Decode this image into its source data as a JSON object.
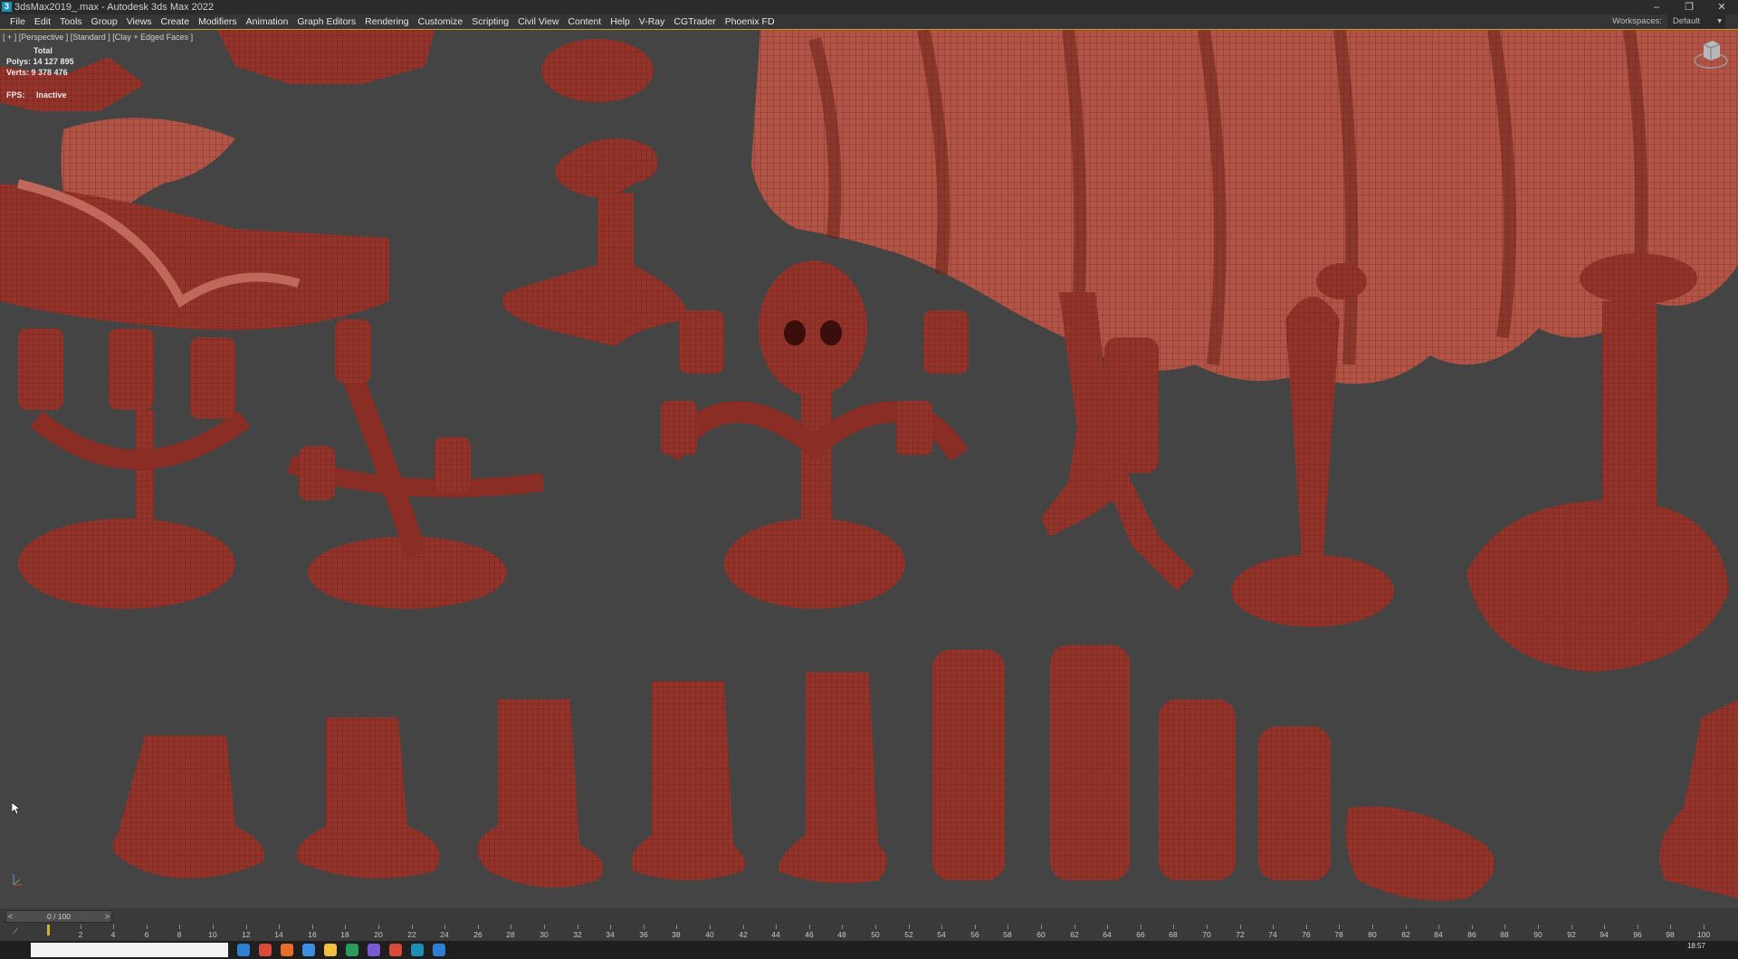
{
  "window": {
    "title": "3dsMax2019_.max - Autodesk 3ds Max 2022",
    "app_icon": "3",
    "controls": [
      "–",
      "❐",
      "✕"
    ]
  },
  "menu": {
    "items": [
      "File",
      "Edit",
      "Tools",
      "Group",
      "Views",
      "Create",
      "Modifiers",
      "Animation",
      "Graph Editors",
      "Rendering",
      "Customize",
      "Scripting",
      "Civil View",
      "Content",
      "Help",
      "V-Ray",
      "CGTrader",
      "Phoenix FD"
    ],
    "workspace_label": "Workspaces:",
    "workspace_value": "Default"
  },
  "viewport": {
    "label": "[ + ] [Perspective ] [Standard ] [Clay + Edged Faces ]",
    "stats": {
      "total_label": "Total",
      "polys_label": "Polys:",
      "polys_value": "14 127 895",
      "verts_label": "Verts:",
      "verts_value": "9 378 476",
      "fps_label": "FPS:",
      "fps_value": "Inactive"
    }
  },
  "timeline": {
    "slider_text": "0 / 100",
    "prev": "<",
    "next": ">",
    "ticks": [
      "2",
      "4",
      "6",
      "8",
      "10",
      "12",
      "14",
      "16",
      "18",
      "20",
      "22",
      "24",
      "26",
      "28",
      "30",
      "32",
      "34",
      "36",
      "38",
      "40",
      "42",
      "44",
      "46",
      "48",
      "50",
      "52",
      "54",
      "56",
      "58",
      "60",
      "62",
      "64",
      "66",
      "68",
      "70",
      "72",
      "74",
      "76",
      "78",
      "80",
      "82",
      "84",
      "86",
      "88",
      "90",
      "92",
      "94",
      "96",
      "98",
      "100"
    ]
  },
  "taskbar": {
    "clock": "18:57"
  },
  "colors": {
    "mesh": "#8e2f24",
    "mesh_light": "#b8574a",
    "background": "#444444",
    "active_border": "#bfa233"
  }
}
